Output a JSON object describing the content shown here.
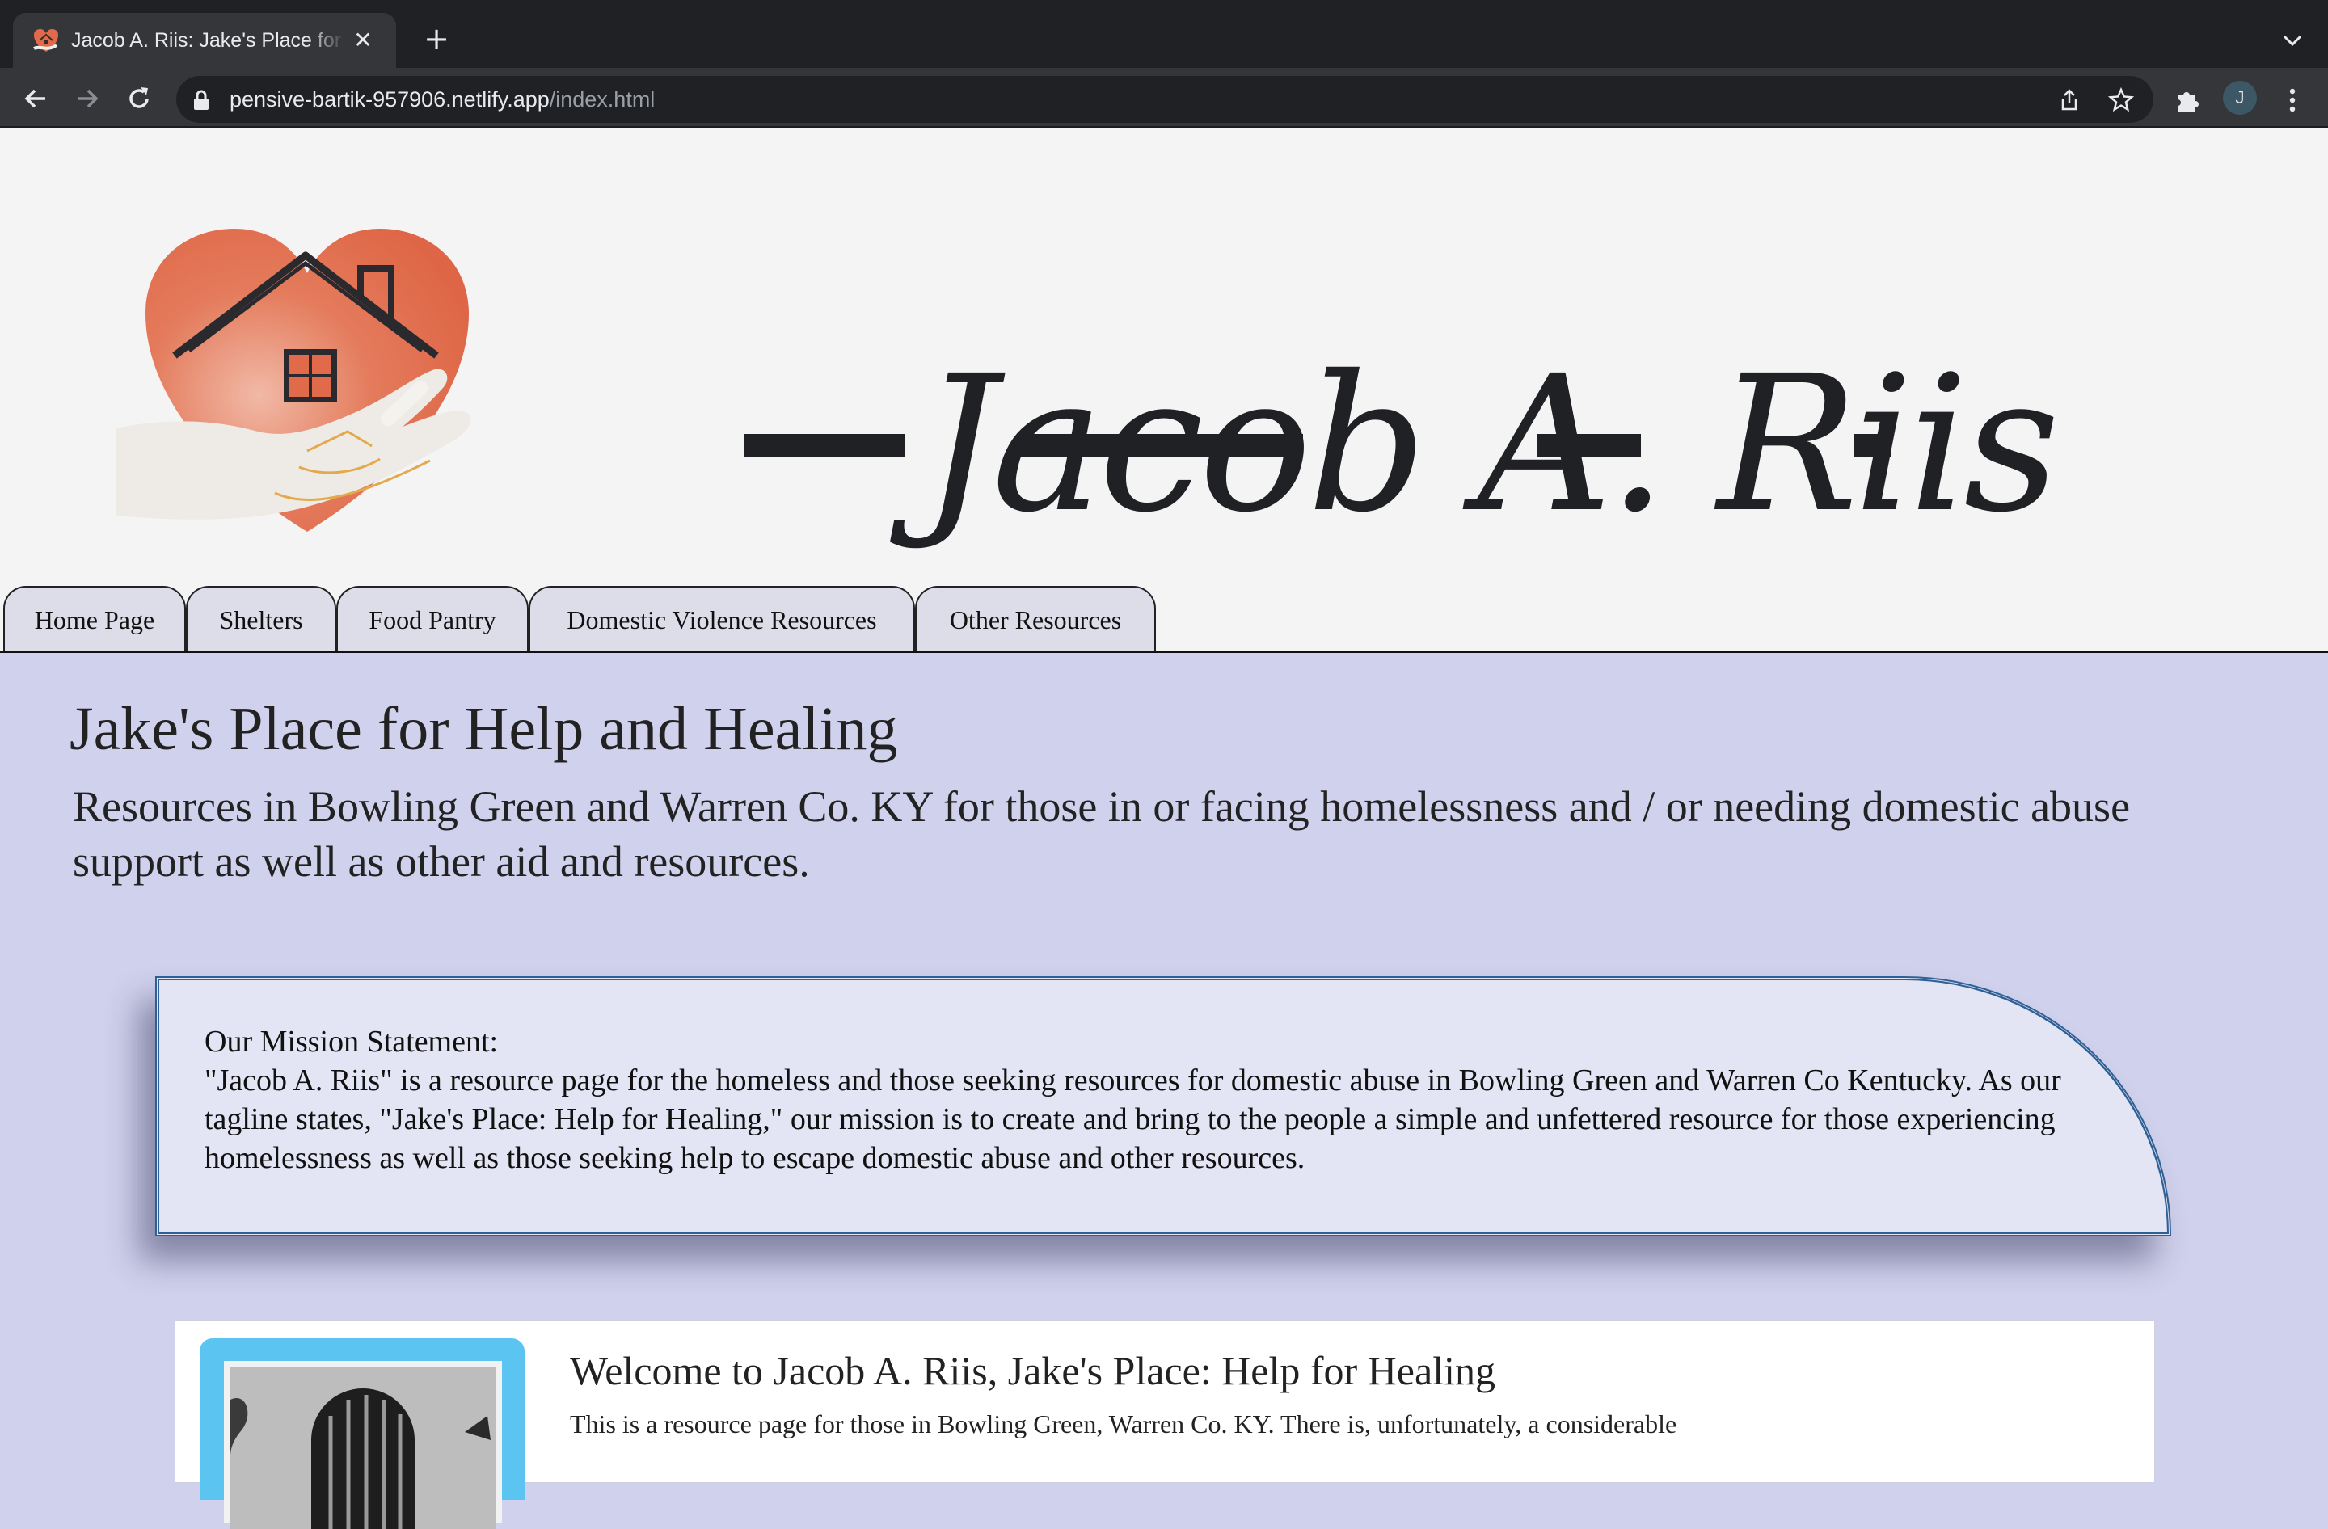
{
  "browser": {
    "tab_title": "Jacob A. Riis: Jake's Place for Help and Healing",
    "url_host": "pensive-bartik-957906.netlify.app",
    "url_path": "/index.html",
    "close_glyph": "✕",
    "newtab_glyph": "+",
    "avatar_initial": "J"
  },
  "header": {
    "site_name": "Jacob A. Riis",
    "logo_icon": "heart-house-in-hand-icon"
  },
  "nav": {
    "tabs": [
      {
        "label": "Home Page"
      },
      {
        "label": "Shelters"
      },
      {
        "label": "Food Pantry"
      },
      {
        "label": "Domestic Violence Resources"
      },
      {
        "label": "Other Resources"
      }
    ]
  },
  "main": {
    "title": "Jake's Place for Help and Healing",
    "subtitle": "Resources in Bowling Green and Warren Co. KY for those in or facing homelessness and / or needing domestic abuse support as well as other aid and resources.",
    "mission_label": "Our Mission Statement:",
    "mission_text": "\"Jacob A. Riis\" is a resource page for the homeless and those seeking resources for domestic abuse in Bowling Green and Warren Co Kentucky. As our tagline states, \"Jake's Place: Help for Healing,\" our mission is to create and bring to the people a simple and unfettered resource for those experiencing homelessness as well as those seeking help to escape domestic abuse and other resources.",
    "welcome_title": "Welcome to Jacob A. Riis, Jake's Place: Help for Healing",
    "welcome_text": "This is a resource page for those in Bowling Green, Warren Co. KY. There is, unfortunately, a considerable"
  },
  "colors": {
    "page_bg": "#d0d1ec",
    "header_bg": "#f4f4f4",
    "heart": "#e06a4a",
    "mission_border": "#2e5f95",
    "photo_frame": "#5bc4f0"
  }
}
